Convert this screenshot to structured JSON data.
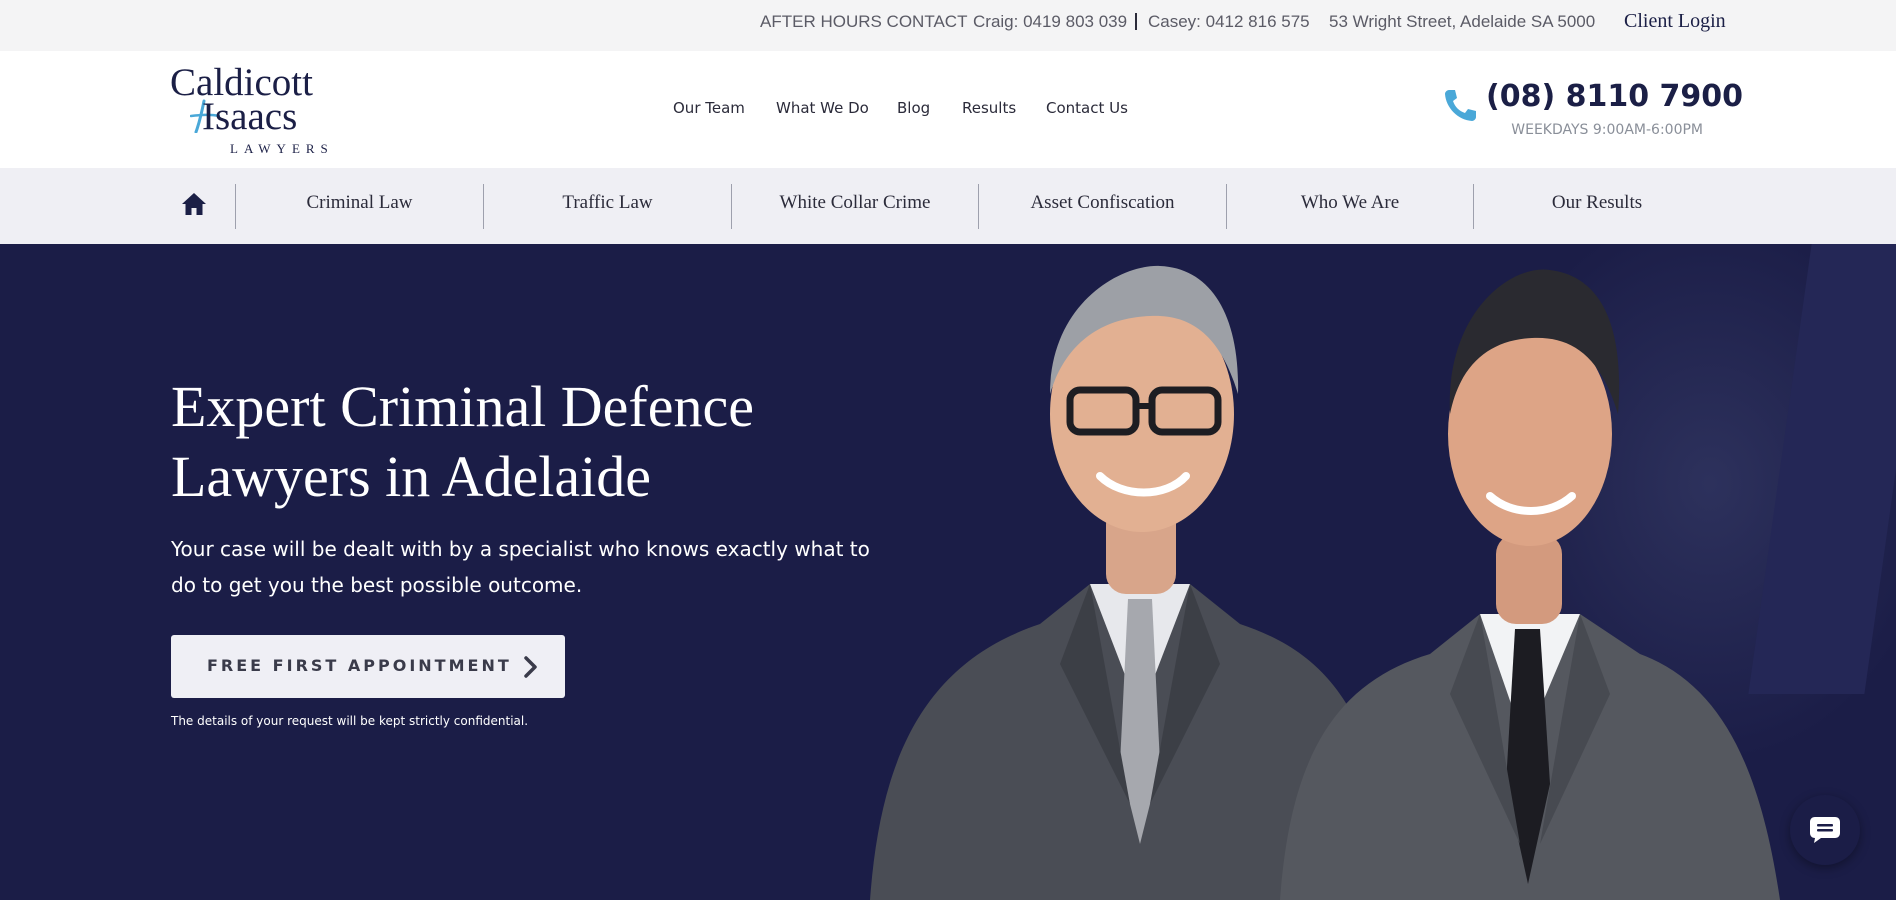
{
  "topbar": {
    "after_hours": "AFTER HOURS CONTACT",
    "craig": "Craig: 0419 803 039",
    "casey": "Casey: 0412 816 575",
    "address": "53 Wright Street, Adelaide SA 5000",
    "client_login": "Client Login"
  },
  "logo": {
    "line1": "Caldicott",
    "line2": "Isaacs",
    "line3": "LAWYERS"
  },
  "main_nav": [
    "Our Team",
    "What We Do",
    "Blog",
    "Results",
    "Contact Us"
  ],
  "contact": {
    "phone": "(08) 8110 7900",
    "hours": "WEEKDAYS 9:00AM-6:00PM"
  },
  "practice_nav": [
    "Criminal Law",
    "Traffic Law",
    "White Collar Crime",
    "Asset Confiscation",
    "Who We Are",
    "Our Results"
  ],
  "hero": {
    "title_line1": "Expert Criminal Defence",
    "title_line2": "Lawyers in Adelaide",
    "subtitle": "Your case will be dealt with by a specialist who knows exactly what to do to get you the best possible outcome.",
    "cta_label": "FREE FIRST APPOINTMENT",
    "note": "The details of your request will be kept strictly confidential."
  },
  "colors": {
    "navy": "#1b1d47",
    "accent_blue": "#4aa8d8",
    "light_bg": "#efeff4"
  },
  "icons": {
    "home": "home-icon",
    "phone": "phone-icon",
    "cta": "chevron-right-icon",
    "chat": "chat-bubble-icon"
  }
}
